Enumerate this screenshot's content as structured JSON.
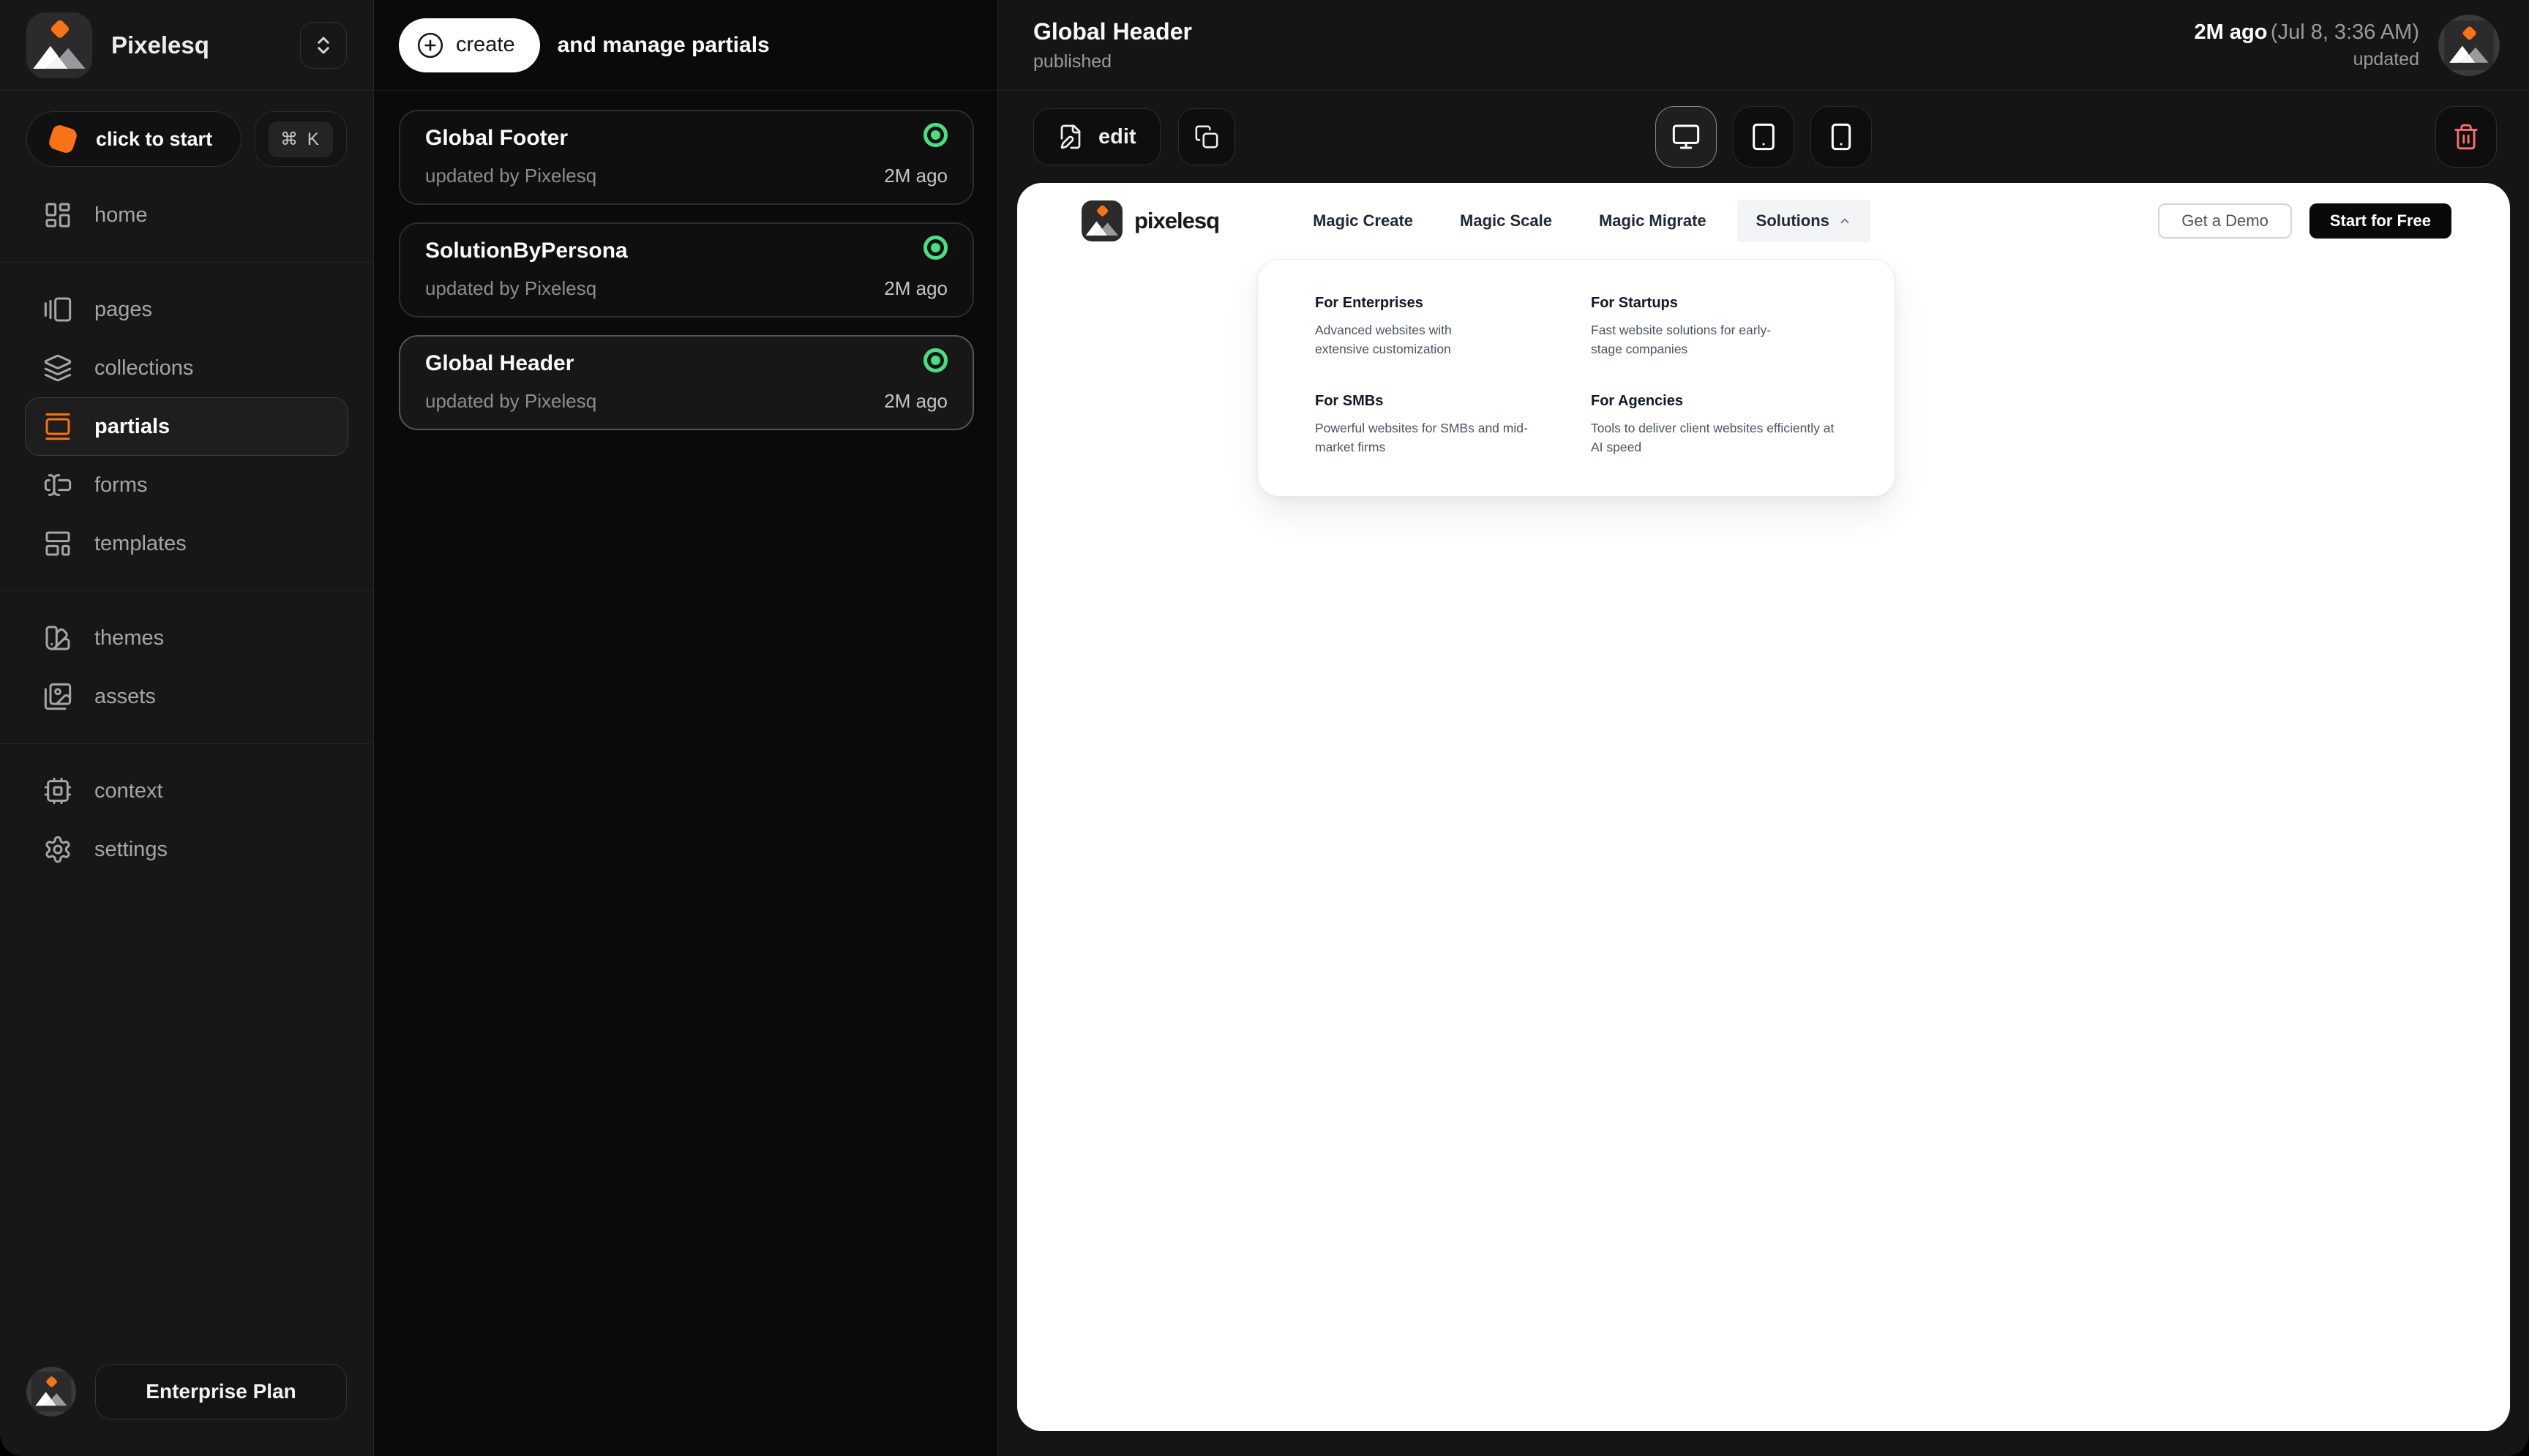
{
  "colors": {
    "accent": "#f97316",
    "published_green": "#4ade80",
    "danger_red": "#f87171"
  },
  "icons": {
    "workspace-logo": "rounded square, orange diamond over white+gray mountains",
    "selector": "chevrons-up-down",
    "shortcut": "command-key",
    "home": "layout-dashboard",
    "pages": "gallery-horizontal-end",
    "collections": "layers",
    "partials": "gallery-vertical",
    "forms": "text-cursor-input",
    "templates": "layout-template",
    "themes": "swatch-book",
    "assets": "images",
    "context": "cpu",
    "settings": "gear",
    "create": "circle-plus",
    "edit": "file-pen",
    "duplicate": "copy",
    "desktop": "monitor",
    "tablet": "tablet",
    "mobile": "smartphone",
    "delete": "trash",
    "status": "green-radio-dot",
    "solutions-caret": "chevron-up"
  },
  "sidebar": {
    "workspace": "Pixelesq",
    "start_label": "click to start",
    "shortcut": "⌘ K",
    "nav": [
      {
        "label": "home"
      },
      {
        "label": "pages"
      },
      {
        "label": "collections"
      },
      {
        "label": "partials"
      },
      {
        "label": "forms"
      },
      {
        "label": "templates"
      },
      {
        "label": "themes"
      },
      {
        "label": "assets"
      },
      {
        "label": "context"
      },
      {
        "label": "settings"
      }
    ],
    "plan_label": "Enterprise Plan"
  },
  "partials_panel": {
    "create_label": "create",
    "subtitle": "and manage partials",
    "items": [
      {
        "title": "Global Footer",
        "updated_by": "updated by Pixelesq",
        "ago": "2M ago"
      },
      {
        "title": "SolutionByPersona",
        "updated_by": "updated by Pixelesq",
        "ago": "2M ago"
      },
      {
        "title": "Global Header",
        "updated_by": "updated by Pixelesq",
        "ago": "2M ago"
      }
    ]
  },
  "detail": {
    "title": "Global Header",
    "status": "published",
    "updated_ago": "2M ago",
    "updated_at": "(Jul 8, 3:36 AM)",
    "updated_label": "updated",
    "edit_label": "edit"
  },
  "preview": {
    "brand": "pixelesq",
    "nav": [
      "Magic Create",
      "Magic Scale",
      "Magic Migrate"
    ],
    "solutions_label": "Solutions",
    "demo_label": "Get a Demo",
    "start_label": "Start for Free",
    "dropdown": {
      "items": [
        {
          "title": "For Enterprises",
          "desc": "Advanced websites with\nextensive customization"
        },
        {
          "title": "For Startups",
          "desc": "Fast website solutions for early-\nstage companies"
        },
        {
          "title": "For SMBs",
          "desc": "Powerful websites for SMBs and mid-\nmarket firms"
        },
        {
          "title": "For Agencies",
          "desc": "Tools to deliver client websites efficiently at\nAI speed"
        }
      ]
    }
  }
}
